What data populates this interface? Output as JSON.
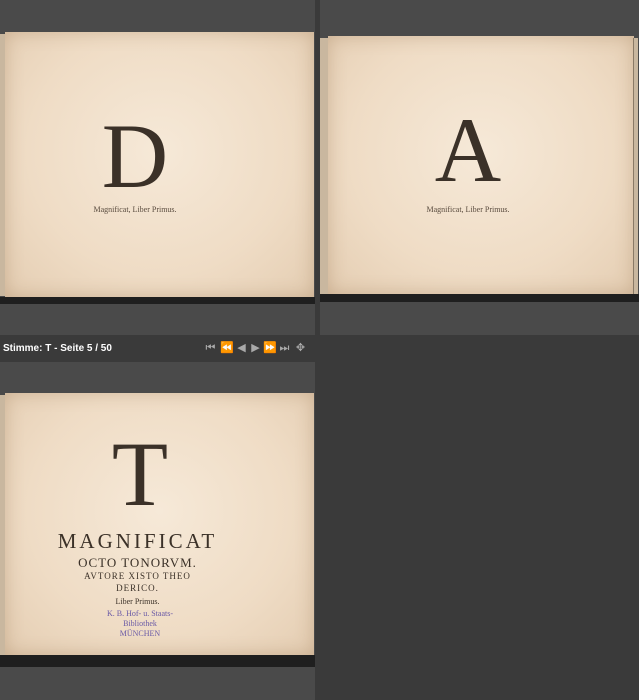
{
  "status": {
    "voice_label": "Stimme: T - Seite 5 / 50"
  },
  "navigation": {
    "first": "⏮",
    "prev_fast": "⏪",
    "prev": "◀",
    "next": "▶",
    "next_fast": "⏩",
    "last": "⏭",
    "move": "✥"
  },
  "page_d": {
    "letter": "D",
    "caption": "Magnificat, Liber Primus."
  },
  "page_a": {
    "letter": "A",
    "caption": "Magnificat, Liber Primus."
  },
  "page_t": {
    "letter": "T",
    "line1": "MAGNIFICAT",
    "line2": "OCTO TONORVM.",
    "line3": "AVTORE XISTO THEO",
    "line4": "DERICO.",
    "line5": "Liber Primus.",
    "stamp1": "K. B. Hof- u. Staats-",
    "stamp2": "Bibliothek",
    "stamp3": "MÜNCHEN"
  }
}
